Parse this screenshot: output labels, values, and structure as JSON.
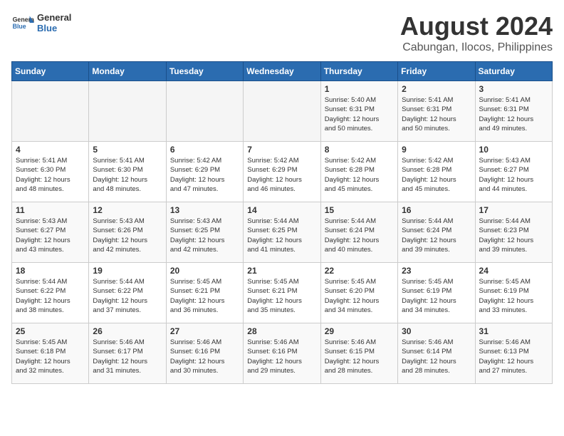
{
  "logo": {
    "text_general": "General",
    "text_blue": "Blue"
  },
  "title": "August 2024",
  "subtitle": "Cabungan, Ilocos, Philippines",
  "days_of_week": [
    "Sunday",
    "Monday",
    "Tuesday",
    "Wednesday",
    "Thursday",
    "Friday",
    "Saturday"
  ],
  "weeks": [
    [
      {
        "day": "",
        "info": ""
      },
      {
        "day": "",
        "info": ""
      },
      {
        "day": "",
        "info": ""
      },
      {
        "day": "",
        "info": ""
      },
      {
        "day": "1",
        "info": "Sunrise: 5:40 AM\nSunset: 6:31 PM\nDaylight: 12 hours\nand 50 minutes."
      },
      {
        "day": "2",
        "info": "Sunrise: 5:41 AM\nSunset: 6:31 PM\nDaylight: 12 hours\nand 50 minutes."
      },
      {
        "day": "3",
        "info": "Sunrise: 5:41 AM\nSunset: 6:31 PM\nDaylight: 12 hours\nand 49 minutes."
      }
    ],
    [
      {
        "day": "4",
        "info": "Sunrise: 5:41 AM\nSunset: 6:30 PM\nDaylight: 12 hours\nand 48 minutes."
      },
      {
        "day": "5",
        "info": "Sunrise: 5:41 AM\nSunset: 6:30 PM\nDaylight: 12 hours\nand 48 minutes."
      },
      {
        "day": "6",
        "info": "Sunrise: 5:42 AM\nSunset: 6:29 PM\nDaylight: 12 hours\nand 47 minutes."
      },
      {
        "day": "7",
        "info": "Sunrise: 5:42 AM\nSunset: 6:29 PM\nDaylight: 12 hours\nand 46 minutes."
      },
      {
        "day": "8",
        "info": "Sunrise: 5:42 AM\nSunset: 6:28 PM\nDaylight: 12 hours\nand 45 minutes."
      },
      {
        "day": "9",
        "info": "Sunrise: 5:42 AM\nSunset: 6:28 PM\nDaylight: 12 hours\nand 45 minutes."
      },
      {
        "day": "10",
        "info": "Sunrise: 5:43 AM\nSunset: 6:27 PM\nDaylight: 12 hours\nand 44 minutes."
      }
    ],
    [
      {
        "day": "11",
        "info": "Sunrise: 5:43 AM\nSunset: 6:27 PM\nDaylight: 12 hours\nand 43 minutes."
      },
      {
        "day": "12",
        "info": "Sunrise: 5:43 AM\nSunset: 6:26 PM\nDaylight: 12 hours\nand 42 minutes."
      },
      {
        "day": "13",
        "info": "Sunrise: 5:43 AM\nSunset: 6:25 PM\nDaylight: 12 hours\nand 42 minutes."
      },
      {
        "day": "14",
        "info": "Sunrise: 5:44 AM\nSunset: 6:25 PM\nDaylight: 12 hours\nand 41 minutes."
      },
      {
        "day": "15",
        "info": "Sunrise: 5:44 AM\nSunset: 6:24 PM\nDaylight: 12 hours\nand 40 minutes."
      },
      {
        "day": "16",
        "info": "Sunrise: 5:44 AM\nSunset: 6:24 PM\nDaylight: 12 hours\nand 39 minutes."
      },
      {
        "day": "17",
        "info": "Sunrise: 5:44 AM\nSunset: 6:23 PM\nDaylight: 12 hours\nand 39 minutes."
      }
    ],
    [
      {
        "day": "18",
        "info": "Sunrise: 5:44 AM\nSunset: 6:22 PM\nDaylight: 12 hours\nand 38 minutes."
      },
      {
        "day": "19",
        "info": "Sunrise: 5:44 AM\nSunset: 6:22 PM\nDaylight: 12 hours\nand 37 minutes."
      },
      {
        "day": "20",
        "info": "Sunrise: 5:45 AM\nSunset: 6:21 PM\nDaylight: 12 hours\nand 36 minutes."
      },
      {
        "day": "21",
        "info": "Sunrise: 5:45 AM\nSunset: 6:21 PM\nDaylight: 12 hours\nand 35 minutes."
      },
      {
        "day": "22",
        "info": "Sunrise: 5:45 AM\nSunset: 6:20 PM\nDaylight: 12 hours\nand 34 minutes."
      },
      {
        "day": "23",
        "info": "Sunrise: 5:45 AM\nSunset: 6:19 PM\nDaylight: 12 hours\nand 34 minutes."
      },
      {
        "day": "24",
        "info": "Sunrise: 5:45 AM\nSunset: 6:19 PM\nDaylight: 12 hours\nand 33 minutes."
      }
    ],
    [
      {
        "day": "25",
        "info": "Sunrise: 5:45 AM\nSunset: 6:18 PM\nDaylight: 12 hours\nand 32 minutes."
      },
      {
        "day": "26",
        "info": "Sunrise: 5:46 AM\nSunset: 6:17 PM\nDaylight: 12 hours\nand 31 minutes."
      },
      {
        "day": "27",
        "info": "Sunrise: 5:46 AM\nSunset: 6:16 PM\nDaylight: 12 hours\nand 30 minutes."
      },
      {
        "day": "28",
        "info": "Sunrise: 5:46 AM\nSunset: 6:16 PM\nDaylight: 12 hours\nand 29 minutes."
      },
      {
        "day": "29",
        "info": "Sunrise: 5:46 AM\nSunset: 6:15 PM\nDaylight: 12 hours\nand 28 minutes."
      },
      {
        "day": "30",
        "info": "Sunrise: 5:46 AM\nSunset: 6:14 PM\nDaylight: 12 hours\nand 28 minutes."
      },
      {
        "day": "31",
        "info": "Sunrise: 5:46 AM\nSunset: 6:13 PM\nDaylight: 12 hours\nand 27 minutes."
      }
    ]
  ]
}
